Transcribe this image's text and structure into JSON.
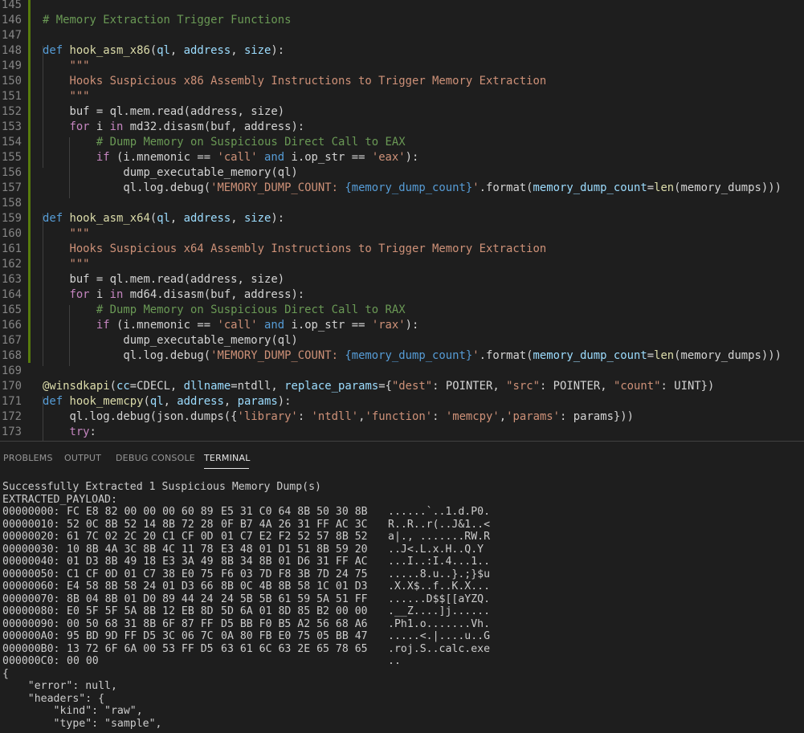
{
  "editor": {
    "lines": [
      {
        "n": "145",
        "tokens": []
      },
      {
        "n": "146",
        "tokens": [
          {
            "t": "# Memory Extraction Trigger Functions",
            "c": "cm"
          }
        ]
      },
      {
        "n": "147",
        "tokens": []
      },
      {
        "n": "148",
        "tokens": [
          {
            "t": "def ",
            "c": "kw"
          },
          {
            "t": "hook_asm_x86",
            "c": "fn"
          },
          {
            "t": "(",
            "c": "pl"
          },
          {
            "t": "ql",
            "c": "var"
          },
          {
            "t": ", ",
            "c": "pl"
          },
          {
            "t": "address",
            "c": "var"
          },
          {
            "t": ", ",
            "c": "pl"
          },
          {
            "t": "size",
            "c": "var"
          },
          {
            "t": "):",
            "c": "pl"
          }
        ]
      },
      {
        "n": "149",
        "tokens": [
          {
            "t": "    \"\"\"",
            "c": "str"
          }
        ]
      },
      {
        "n": "150",
        "tokens": [
          {
            "t": "    Hooks Suspicious x86 Assembly Instructions to Trigger Memory Extraction",
            "c": "str"
          }
        ]
      },
      {
        "n": "151",
        "tokens": [
          {
            "t": "    \"\"\"",
            "c": "str"
          }
        ]
      },
      {
        "n": "152",
        "tokens": [
          {
            "t": "    buf = ql.mem.read(address, size)",
            "c": "pl"
          }
        ]
      },
      {
        "n": "153",
        "tokens": [
          {
            "t": "    ",
            "c": "pl"
          },
          {
            "t": "for",
            "c": "ctl"
          },
          {
            "t": " i ",
            "c": "pl"
          },
          {
            "t": "in",
            "c": "ctl"
          },
          {
            "t": " md32.disasm(buf, address):",
            "c": "pl"
          }
        ]
      },
      {
        "n": "154",
        "tokens": [
          {
            "t": "        # Dump Memory on Suspicious Direct Call to EAX",
            "c": "cm"
          }
        ]
      },
      {
        "n": "155",
        "tokens": [
          {
            "t": "        ",
            "c": "pl"
          },
          {
            "t": "if",
            "c": "ctl"
          },
          {
            "t": " (i.mnemonic == ",
            "c": "pl"
          },
          {
            "t": "'call'",
            "c": "str"
          },
          {
            "t": " ",
            "c": "pl"
          },
          {
            "t": "and",
            "c": "bl"
          },
          {
            "t": " i.op_str == ",
            "c": "pl"
          },
          {
            "t": "'eax'",
            "c": "str"
          },
          {
            "t": "):",
            "c": "pl"
          }
        ]
      },
      {
        "n": "156",
        "tokens": [
          {
            "t": "            dump_executable_memory(ql)",
            "c": "pl"
          }
        ]
      },
      {
        "n": "157",
        "tokens": [
          {
            "t": "            ql.log.debug(",
            "c": "pl"
          },
          {
            "t": "'MEMORY_DUMP_COUNT: ",
            "c": "str"
          },
          {
            "t": "{memory_dump_count}",
            "c": "bl"
          },
          {
            "t": "'",
            "c": "str"
          },
          {
            "t": ".format(",
            "c": "pl"
          },
          {
            "t": "memory_dump_count",
            "c": "var"
          },
          {
            "t": "=",
            "c": "pl"
          },
          {
            "t": "len",
            "c": "fn"
          },
          {
            "t": "(memory_dumps)))",
            "c": "pl"
          }
        ]
      },
      {
        "n": "158",
        "tokens": []
      },
      {
        "n": "159",
        "tokens": [
          {
            "t": "def ",
            "c": "kw"
          },
          {
            "t": "hook_asm_x64",
            "c": "fn"
          },
          {
            "t": "(",
            "c": "pl"
          },
          {
            "t": "ql",
            "c": "var"
          },
          {
            "t": ", ",
            "c": "pl"
          },
          {
            "t": "address",
            "c": "var"
          },
          {
            "t": ", ",
            "c": "pl"
          },
          {
            "t": "size",
            "c": "var"
          },
          {
            "t": "):",
            "c": "pl"
          }
        ]
      },
      {
        "n": "160",
        "tokens": [
          {
            "t": "    \"\"\"",
            "c": "str"
          }
        ]
      },
      {
        "n": "161",
        "tokens": [
          {
            "t": "    Hooks Suspicious x64 Assembly Instructions to Trigger Memory Extraction",
            "c": "str"
          }
        ]
      },
      {
        "n": "162",
        "tokens": [
          {
            "t": "    \"\"\"",
            "c": "str"
          }
        ]
      },
      {
        "n": "163",
        "tokens": [
          {
            "t": "    buf = ql.mem.read(address, size)",
            "c": "pl"
          }
        ]
      },
      {
        "n": "164",
        "tokens": [
          {
            "t": "    ",
            "c": "pl"
          },
          {
            "t": "for",
            "c": "ctl"
          },
          {
            "t": " i ",
            "c": "pl"
          },
          {
            "t": "in",
            "c": "ctl"
          },
          {
            "t": " md64.disasm(buf, address):",
            "c": "pl"
          }
        ]
      },
      {
        "n": "165",
        "tokens": [
          {
            "t": "        # Dump Memory on Suspicious Direct Call to RAX",
            "c": "cm"
          }
        ]
      },
      {
        "n": "166",
        "tokens": [
          {
            "t": "        ",
            "c": "pl"
          },
          {
            "t": "if",
            "c": "ctl"
          },
          {
            "t": " (i.mnemonic == ",
            "c": "pl"
          },
          {
            "t": "'call'",
            "c": "str"
          },
          {
            "t": " ",
            "c": "pl"
          },
          {
            "t": "and",
            "c": "bl"
          },
          {
            "t": " i.op_str == ",
            "c": "pl"
          },
          {
            "t": "'rax'",
            "c": "str"
          },
          {
            "t": "):",
            "c": "pl"
          }
        ]
      },
      {
        "n": "167",
        "tokens": [
          {
            "t": "            dump_executable_memory(ql)",
            "c": "pl"
          }
        ]
      },
      {
        "n": "168",
        "tokens": [
          {
            "t": "            ql.log.debug(",
            "c": "pl"
          },
          {
            "t": "'MEMORY_DUMP_COUNT: ",
            "c": "str"
          },
          {
            "t": "{memory_dump_count}",
            "c": "bl"
          },
          {
            "t": "'",
            "c": "str"
          },
          {
            "t": ".format(",
            "c": "pl"
          },
          {
            "t": "memory_dump_count",
            "c": "var"
          },
          {
            "t": "=",
            "c": "pl"
          },
          {
            "t": "len",
            "c": "fn"
          },
          {
            "t": "(memory_dumps)))",
            "c": "pl"
          }
        ]
      },
      {
        "n": "169",
        "tokens": []
      },
      {
        "n": "170",
        "tokens": [
          {
            "t": "@winsdkapi",
            "c": "fn"
          },
          {
            "t": "(",
            "c": "pl"
          },
          {
            "t": "cc",
            "c": "var"
          },
          {
            "t": "=CDECL, ",
            "c": "pl"
          },
          {
            "t": "dllname",
            "c": "var"
          },
          {
            "t": "=ntdll, ",
            "c": "pl"
          },
          {
            "t": "replace_params",
            "c": "var"
          },
          {
            "t": "={",
            "c": "pl"
          },
          {
            "t": "\"dest\"",
            "c": "str"
          },
          {
            "t": ": POINTER, ",
            "c": "pl"
          },
          {
            "t": "\"src\"",
            "c": "str"
          },
          {
            "t": ": POINTER, ",
            "c": "pl"
          },
          {
            "t": "\"count\"",
            "c": "str"
          },
          {
            "t": ": UINT})",
            "c": "pl"
          }
        ]
      },
      {
        "n": "171",
        "tokens": [
          {
            "t": "def ",
            "c": "kw"
          },
          {
            "t": "hook_memcpy",
            "c": "fn"
          },
          {
            "t": "(",
            "c": "pl"
          },
          {
            "t": "ql",
            "c": "var"
          },
          {
            "t": ", ",
            "c": "pl"
          },
          {
            "t": "address",
            "c": "var"
          },
          {
            "t": ", ",
            "c": "pl"
          },
          {
            "t": "params",
            "c": "var"
          },
          {
            "t": "):",
            "c": "pl"
          }
        ]
      },
      {
        "n": "172",
        "tokens": [
          {
            "t": "    ql.log.debug(json.dumps({",
            "c": "pl"
          },
          {
            "t": "'library'",
            "c": "str"
          },
          {
            "t": ": ",
            "c": "pl"
          },
          {
            "t": "'ntdll'",
            "c": "str"
          },
          {
            "t": ",",
            "c": "pl"
          },
          {
            "t": "'function'",
            "c": "str"
          },
          {
            "t": ": ",
            "c": "pl"
          },
          {
            "t": "'memcpy'",
            "c": "str"
          },
          {
            "t": ",",
            "c": "pl"
          },
          {
            "t": "'params'",
            "c": "str"
          },
          {
            "t": ": params}))",
            "c": "pl"
          }
        ]
      },
      {
        "n": "173",
        "tokens": [
          {
            "t": "    ",
            "c": "pl"
          },
          {
            "t": "try",
            "c": "ctl"
          },
          {
            "t": ":",
            "c": "pl"
          }
        ]
      }
    ]
  },
  "panel": {
    "tabs": [
      {
        "label": "PROBLEMS",
        "active": false
      },
      {
        "label": "OUTPUT",
        "active": false
      },
      {
        "label": "DEBUG CONSOLE",
        "active": false
      },
      {
        "label": "TERMINAL",
        "active": true
      }
    ]
  },
  "terminal": {
    "status": "Successfully Extracted 1 Suspicious Memory Dump(s)",
    "payload_label": "EXTRACTED_PAYLOAD:",
    "hex": [
      {
        "off": "00000000:",
        "a": "FC E8 82 00 00 00 60 89",
        "b": "E5 31 C0 64 8B 50 30 8B",
        "ascii": "......`..1.d.P0."
      },
      {
        "off": "00000010:",
        "a": "52 0C 8B 52 14 8B 72 28",
        "b": "0F B7 4A 26 31 FF AC 3C",
        "ascii": "R..R..r(..J&1..<"
      },
      {
        "off": "00000020:",
        "a": "61 7C 02 2C 20 C1 CF 0D",
        "b": "01 C7 E2 F2 52 57 8B 52",
        "ascii": "a|., .......RW.R"
      },
      {
        "off": "00000030:",
        "a": "10 8B 4A 3C 8B 4C 11 78",
        "b": "E3 48 01 D1 51 8B 59 20",
        "ascii": "..J<.L.x.H..Q.Y"
      },
      {
        "off": "00000040:",
        "a": "01 D3 8B 49 18 E3 3A 49",
        "b": "8B 34 8B 01 D6 31 FF AC",
        "ascii": "...I..:I.4...1.."
      },
      {
        "off": "00000050:",
        "a": "C1 CF 0D 01 C7 38 E0 75",
        "b": "F6 03 7D F8 3B 7D 24 75",
        "ascii": ".....8.u..}.;}$u"
      },
      {
        "off": "00000060:",
        "a": "E4 58 8B 58 24 01 D3 66",
        "b": "8B 0C 4B 8B 58 1C 01 D3",
        "ascii": ".X.X$..f..K.X..."
      },
      {
        "off": "00000070:",
        "a": "8B 04 8B 01 D0 89 44 24",
        "b": "24 5B 5B 61 59 5A 51 FF",
        "ascii": "......D$$[[aYZQ."
      },
      {
        "off": "00000080:",
        "a": "E0 5F 5F 5A 8B 12 EB 8D",
        "b": "5D 6A 01 8D 85 B2 00 00",
        "ascii": ".__Z....]j......"
      },
      {
        "off": "00000090:",
        "a": "00 50 68 31 8B 6F 87 FF",
        "b": "D5 BB F0 B5 A2 56 68 A6",
        "ascii": ".Ph1.o.......Vh."
      },
      {
        "off": "000000A0:",
        "a": "95 BD 9D FF D5 3C 06 7C",
        "b": "0A 80 FB E0 75 05 BB 47",
        "ascii": ".....<.|....u..G"
      },
      {
        "off": "000000B0:",
        "a": "13 72 6F 6A 00 53 FF D5",
        "b": "63 61 6C 63 2E 65 78 65",
        "ascii": ".roj.S..calc.exe"
      },
      {
        "off": "000000C0:",
        "a": "00 00",
        "b": "",
        "ascii": ".."
      }
    ],
    "json_lines": [
      "{",
      "    \"error\": null,",
      "    \"headers\": {",
      "        \"kind\": \"raw\",",
      "        \"type\": \"sample\","
    ]
  },
  "colors": {
    "background": "#1e1e1e",
    "keyword": "#569cd6",
    "control": "#c586c0",
    "function": "#dcdcaa",
    "variable": "#9cdcfe",
    "string": "#ce9178",
    "comment": "#6a9955",
    "git_modified": "#587c0c"
  }
}
